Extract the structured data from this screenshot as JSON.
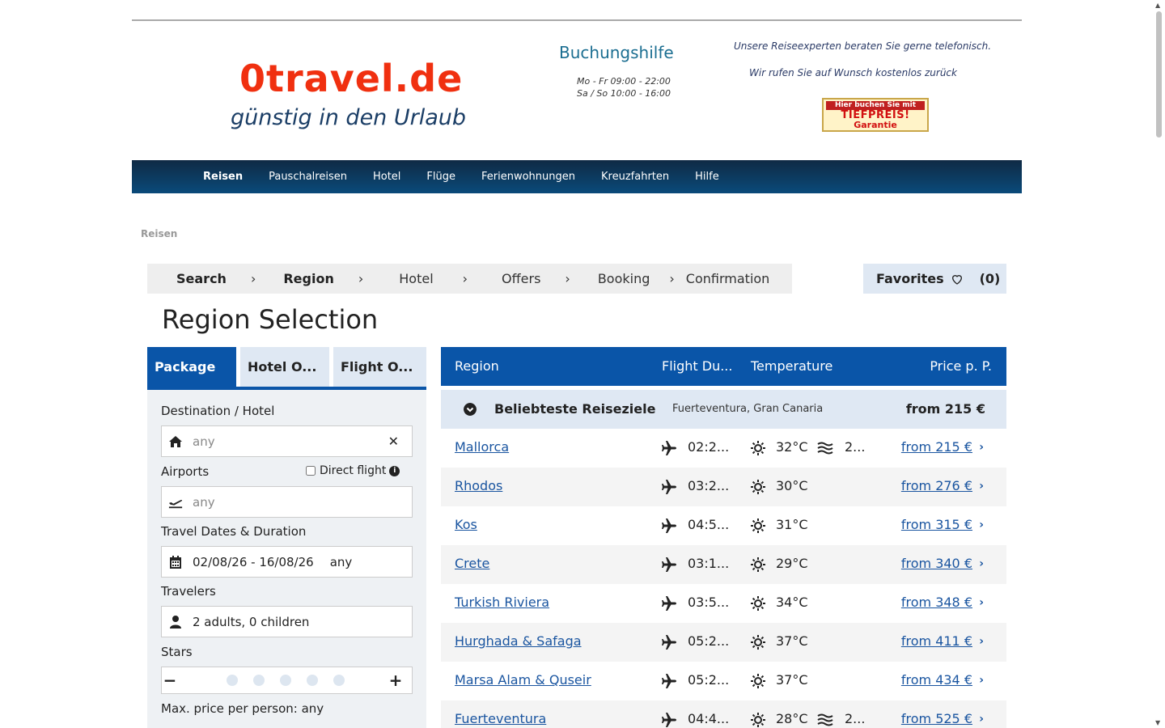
{
  "header": {
    "logo_main": "0travel.de",
    "logo_sub": "günstig in den Urlaub",
    "help_title": "Buchungshilfe",
    "hours_1": "Mo - Fr 09:00 - 22:00",
    "hours_2": "Sa / So 10:00 - 16:00",
    "expert_1": "Unsere Reiseexperten beraten Sie gerne telefonisch.",
    "expert_2": "Wir rufen Sie auf Wunsch kostenlos zurück",
    "badge_1": "Hier buchen Sie mit",
    "badge_2": "TIEFPREIS!",
    "badge_3": "Garantie"
  },
  "nav": [
    "Reisen",
    "Pauschalreisen",
    "Hotel",
    "Flüge",
    "Ferienwohnungen",
    "Kreuzfahrten",
    "Hilfe"
  ],
  "breadcrumb": "Reisen",
  "steps": [
    "Search",
    "Region",
    "Hotel",
    "Offers",
    "Booking",
    "Confirmation"
  ],
  "favorites": {
    "label": "Favorites",
    "count": "(0)"
  },
  "page_title": "Region Selection",
  "tabs": [
    "Package",
    "Hotel O...",
    "Flight O..."
  ],
  "form": {
    "dest_label": "Destination / Hotel",
    "dest_ph": "any",
    "airports_label": "Airports",
    "direct_label": "Direct flight",
    "airports_ph": "any",
    "dates_label": "Travel Dates & Duration",
    "dates_val": "02/08/26 - 16/08/26",
    "duration_val": "any",
    "travelers_label": "Travelers",
    "travelers_val": "2 adults, 0 children",
    "stars_label": "Stars",
    "maxprice_label": "Max. price per person: any"
  },
  "results_header": {
    "region": "Region",
    "flight": "Flight Du...",
    "temp": "Temperature",
    "price": "Price p. P."
  },
  "group": {
    "title": "Beliebteste Reiseziele",
    "sub": "Fuerteventura, Gran Canaria",
    "price": "from 215 €"
  },
  "rows": [
    {
      "name": "Mallorca",
      "dur": "02:2...",
      "temp": "32°C",
      "water": "2...",
      "price": "from 215 €"
    },
    {
      "name": "Rhodos",
      "dur": "03:2...",
      "temp": "30°C",
      "water": "",
      "price": "from 276 €"
    },
    {
      "name": "Kos",
      "dur": "04:5...",
      "temp": "31°C",
      "water": "",
      "price": "from 315 €"
    },
    {
      "name": "Crete",
      "dur": "03:1...",
      "temp": "29°C",
      "water": "",
      "price": "from 340 €"
    },
    {
      "name": "Turkish Riviera",
      "dur": "03:5...",
      "temp": "34°C",
      "water": "",
      "price": "from 348 €"
    },
    {
      "name": "Hurghada & Safaga",
      "dur": "05:2...",
      "temp": "37°C",
      "water": "",
      "price": "from 411 €"
    },
    {
      "name": "Marsa Alam & Quseir",
      "dur": "05:2...",
      "temp": "37°C",
      "water": "",
      "price": "from 434 €"
    },
    {
      "name": "Fuerteventura",
      "dur": "04:4...",
      "temp": "28°C",
      "water": "2...",
      "price": "from 525 €"
    }
  ]
}
